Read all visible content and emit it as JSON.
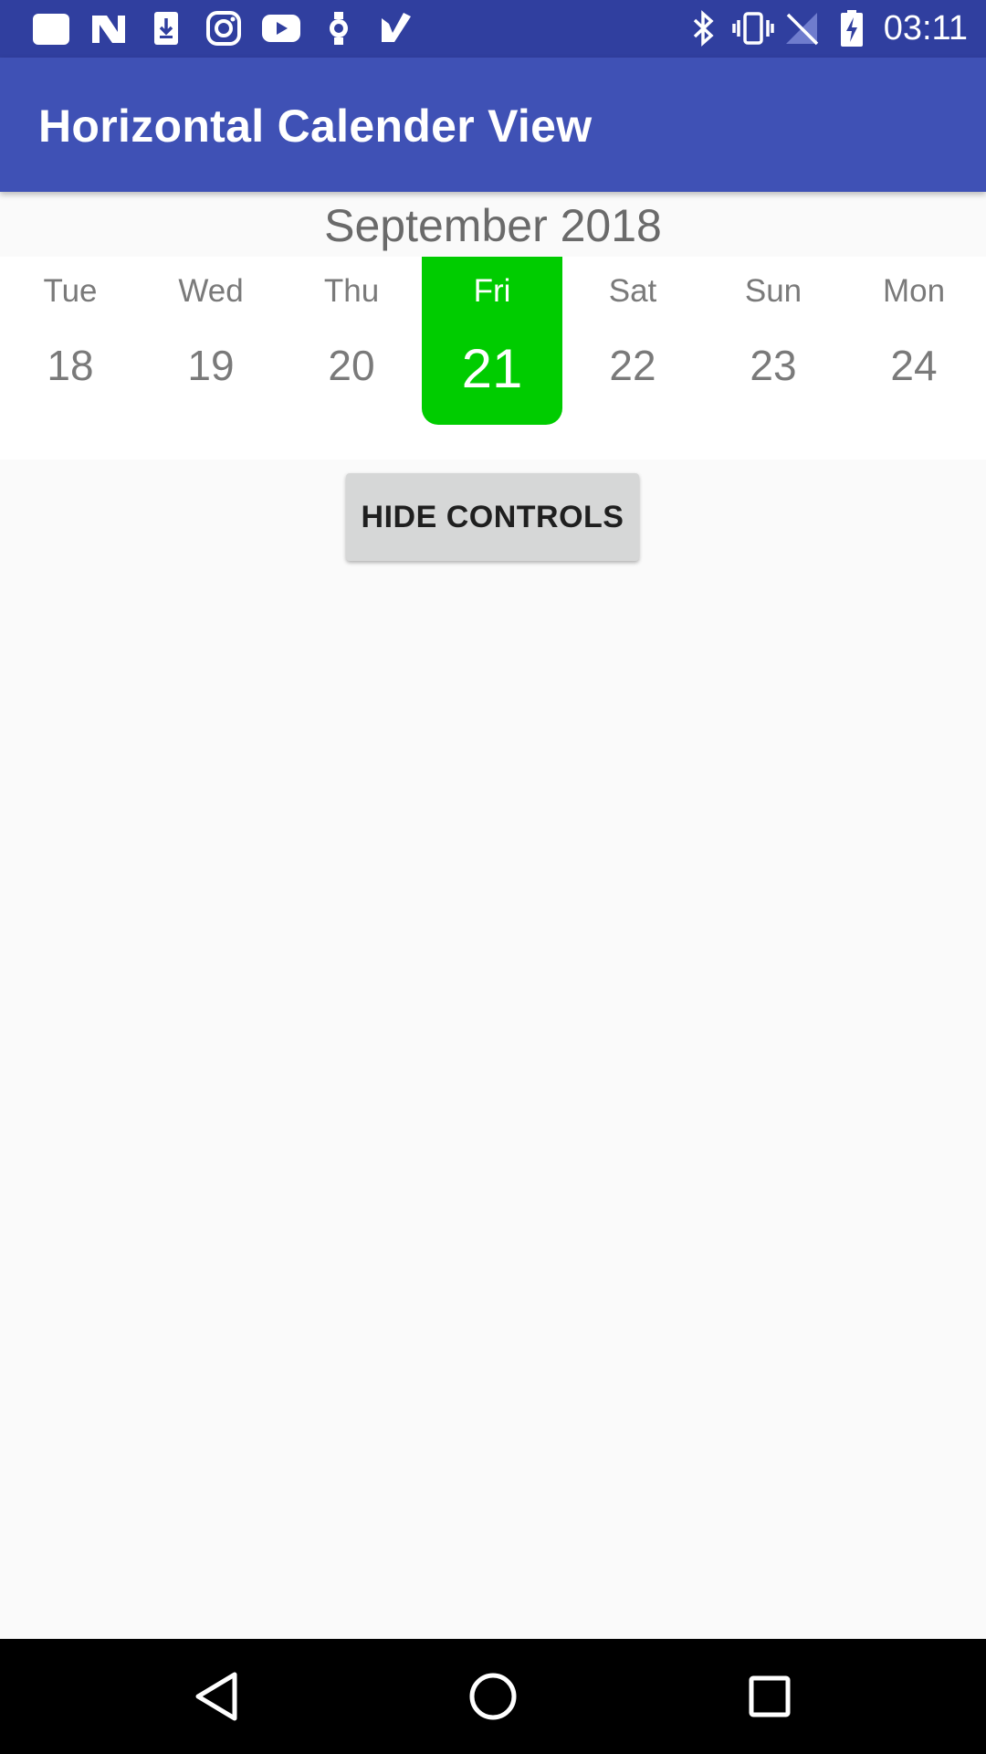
{
  "status_bar": {
    "time": "03:11",
    "left_icons": [
      "notification-icon",
      "n-icon",
      "download-icon",
      "instagram-icon",
      "youtube-icon",
      "watch-icon",
      "check-icon"
    ],
    "right_icons": [
      "bluetooth-icon",
      "vibrate-icon",
      "no-signal-icon",
      "battery-charging-icon"
    ]
  },
  "app_bar": {
    "title": "Horizontal Calender View"
  },
  "calendar": {
    "month_year": "September 2018",
    "days": [
      {
        "dow": "Tue",
        "num": "18",
        "selected": false
      },
      {
        "dow": "Wed",
        "num": "19",
        "selected": false
      },
      {
        "dow": "Thu",
        "num": "20",
        "selected": false
      },
      {
        "dow": "Fri",
        "num": "21",
        "selected": true
      },
      {
        "dow": "Sat",
        "num": "22",
        "selected": false
      },
      {
        "dow": "Sun",
        "num": "23",
        "selected": false
      },
      {
        "dow": "Mon",
        "num": "24",
        "selected": false
      }
    ],
    "selected_color": "#00cc00"
  },
  "controls": {
    "hide_label": "HIDE CONTROLS"
  },
  "nav_bar": {
    "buttons": [
      "back-icon",
      "home-icon",
      "recents-icon"
    ]
  },
  "colors": {
    "status_bar": "#303f9f",
    "app_bar": "#3f51b5",
    "background": "#fafafa"
  }
}
